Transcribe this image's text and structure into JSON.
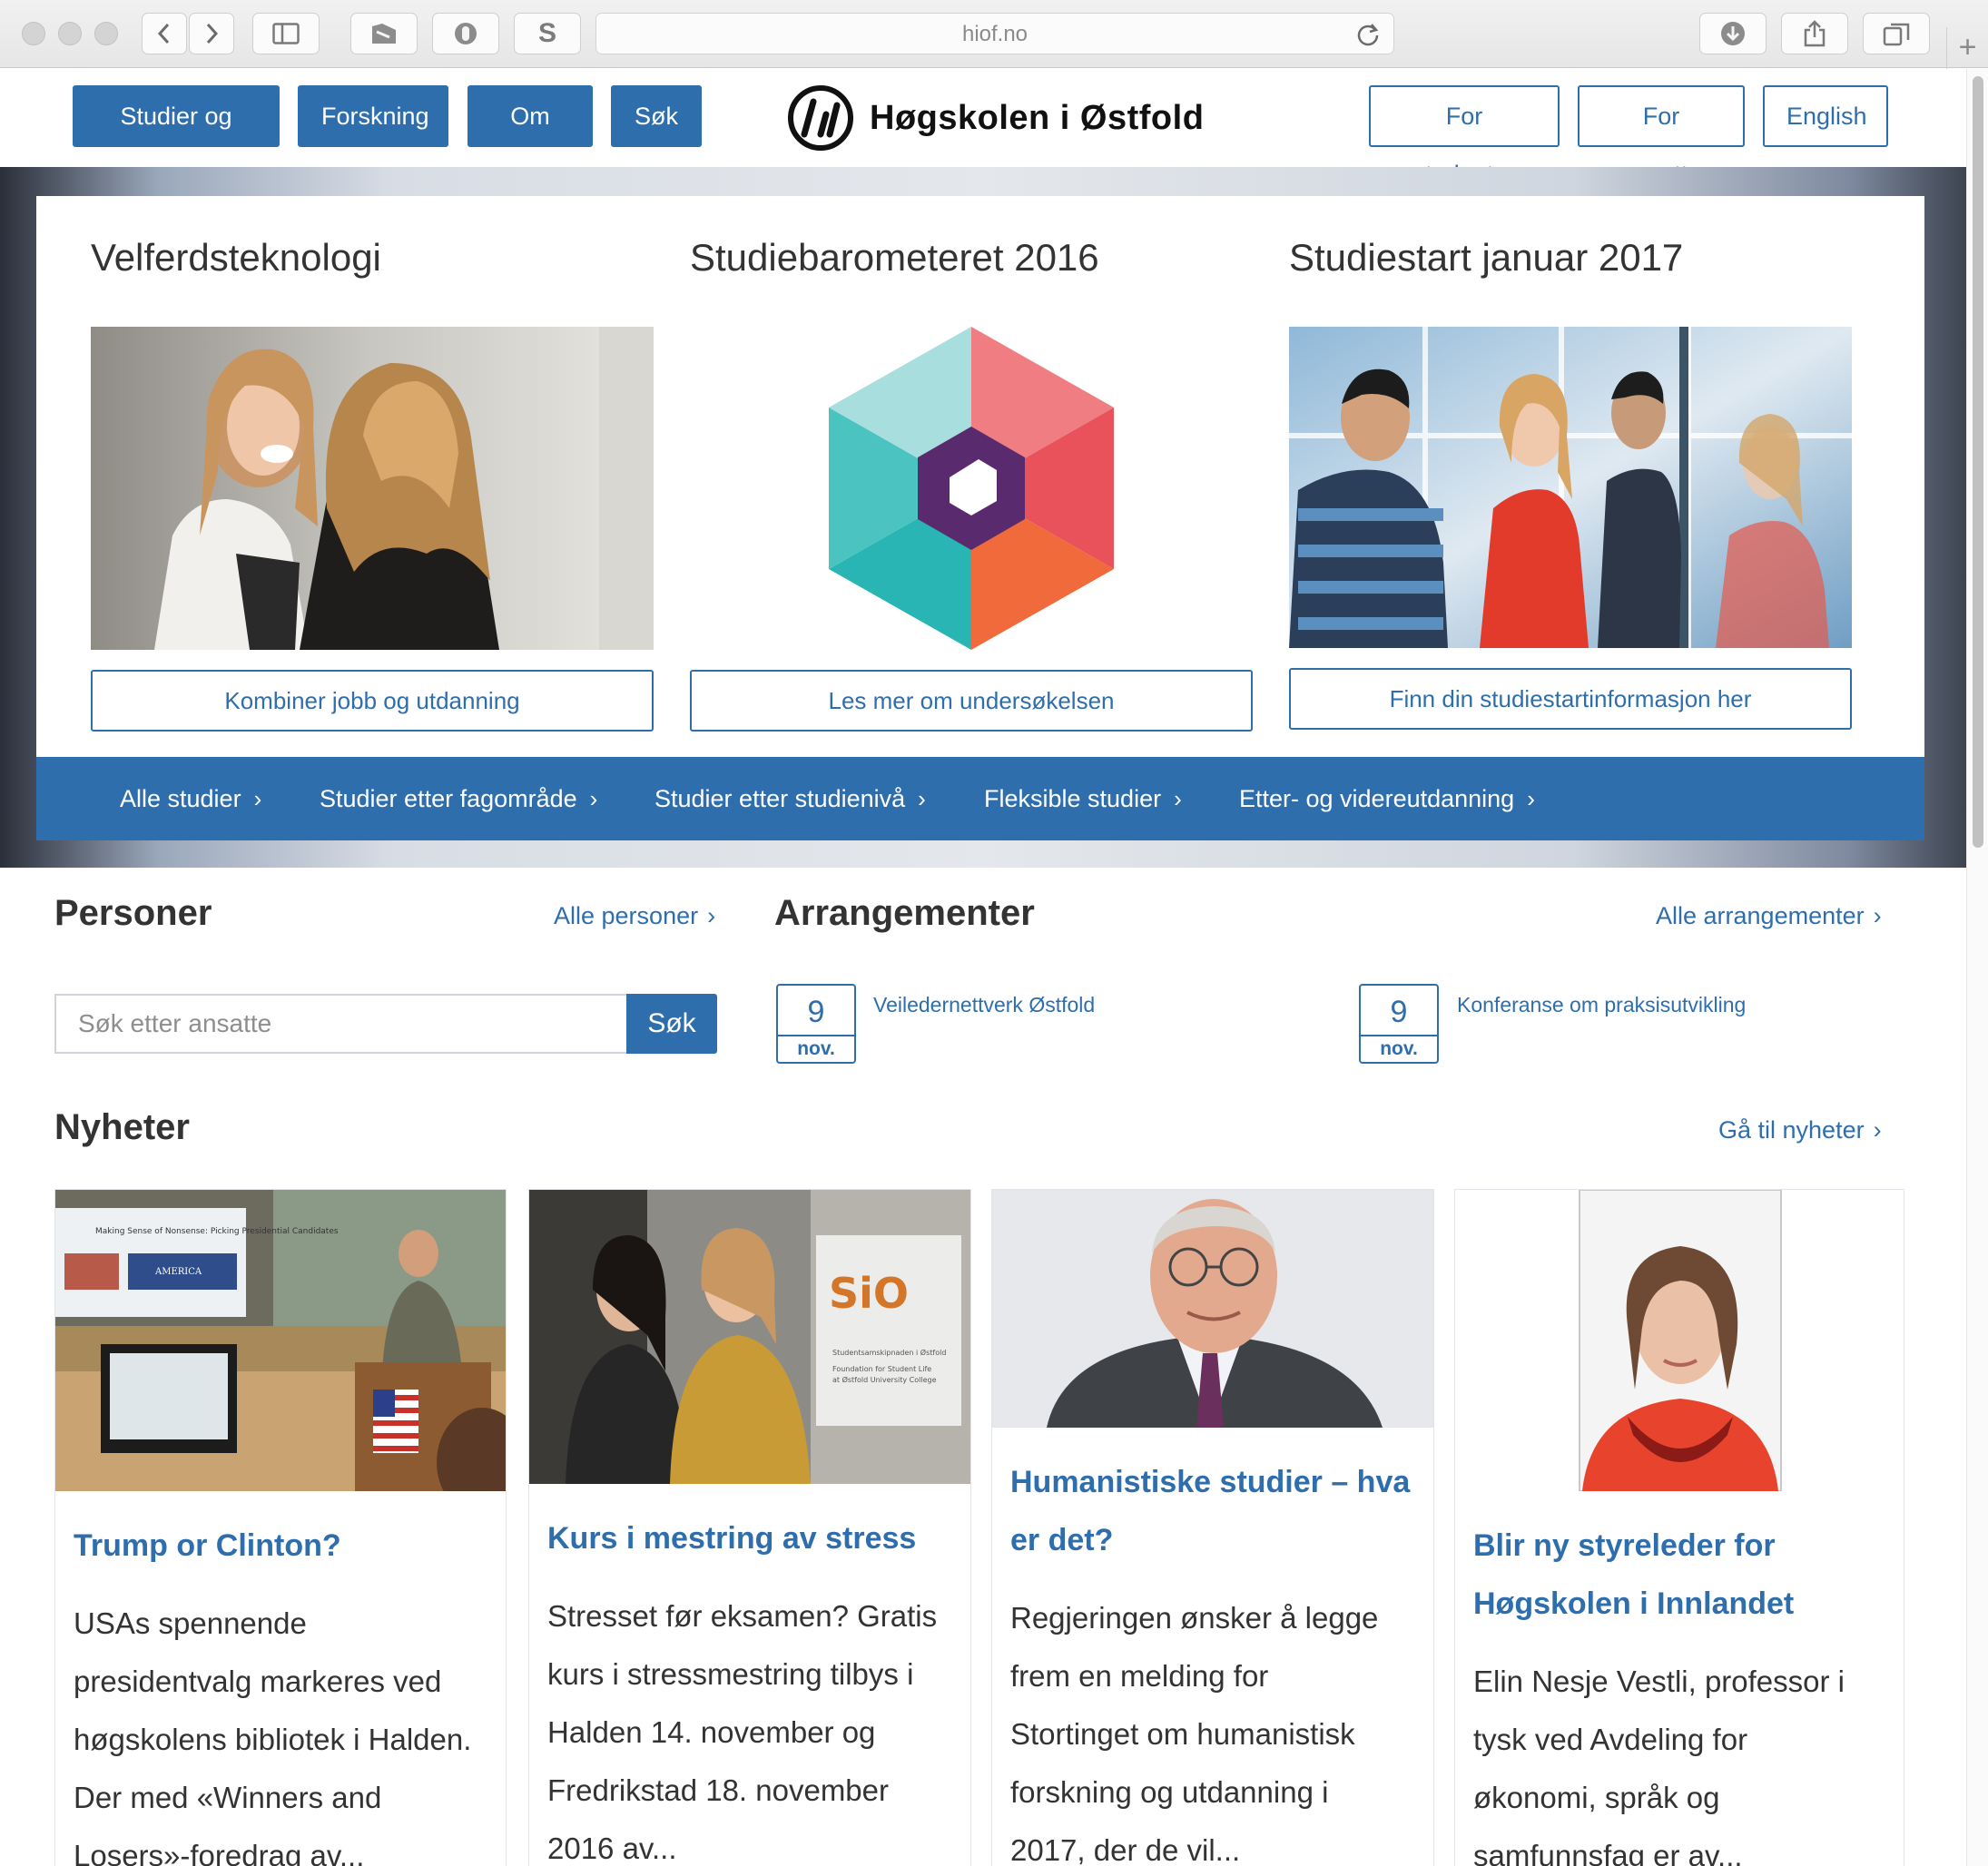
{
  "browser": {
    "url": "hiof.no"
  },
  "header": {
    "nav_primary": [
      "Studier og kurs",
      "Forskning",
      "Om oss",
      "Søk"
    ],
    "logo_text": "Høgskolen i Østfold",
    "nav_secondary": [
      "For studenter",
      "For ansatte",
      "English"
    ],
    "brand_color": "#2f6ead"
  },
  "features": [
    {
      "title": "Velferdsteknologi",
      "button": "Kombiner jobb og utdanning"
    },
    {
      "title": "Studiebarometeret 2016",
      "button": "Les mer om undersøkelsen"
    },
    {
      "title": "Studiestart januar 2017",
      "button": "Finn din studiestartinformasjon her"
    }
  ],
  "study_bar": [
    "Alle studier",
    "Studier etter fagområde",
    "Studier etter studienivå",
    "Fleksible studier",
    "Etter- og videreutdanning"
  ],
  "persons": {
    "title": "Personer",
    "link": "Alle personer",
    "search_placeholder": "Søk etter ansatte",
    "search_button": "Søk"
  },
  "events": {
    "title": "Arrangementer",
    "link": "Alle arrangementer",
    "items": [
      {
        "day": "9",
        "month": "nov.",
        "title": "Veiledernettverk Østfold"
      },
      {
        "day": "9",
        "month": "nov.",
        "title": "Konferanse om praksisutvikling"
      }
    ]
  },
  "news": {
    "title": "Nyheter",
    "link": "Gå til nyheter",
    "items": [
      {
        "title_lines": [
          "Trump or Clinton?"
        ],
        "text_lines": [
          "USAs spennende",
          "presidentvalg markeres ved",
          "høgskolens bibliotek i Halden.",
          "Der med «Winners and",
          "Losers»-foredrag av..."
        ]
      },
      {
        "title_lines": [
          "Kurs i mestring av stress"
        ],
        "text_lines": [
          "Stresset før eksamen? Gratis",
          "kurs i stressmestring tilbys i",
          "Halden 14. november og",
          "Fredrikstad 18. november",
          "2016 av..."
        ]
      },
      {
        "title_lines": [
          "Humanistiske studier – hva",
          "er det?"
        ],
        "text_lines": [
          "Regjeringen ønsker å legge",
          "frem en melding for",
          "Stortinget om humanistisk",
          "forskning og utdanning i",
          "2017, der de vil..."
        ]
      },
      {
        "title_lines": [
          "Blir ny styreleder for",
          "Høgskolen i Innlandet"
        ],
        "text_lines": [
          "Elin Nesje Vestli, professor i",
          "tysk ved Avdeling for",
          "økonomi, språk og",
          "samfunnsfag er av..."
        ]
      }
    ]
  },
  "sign_text": {
    "slide_title": "Making Sense of Nonsense: Picking Presidential Candidates",
    "slide_word": "AMERICA",
    "sio_logo": "SiO",
    "sio_caption": [
      "Studentsamskipnaden i Østfold",
      "Foundation for Student Life",
      "at Østfold University College"
    ]
  }
}
